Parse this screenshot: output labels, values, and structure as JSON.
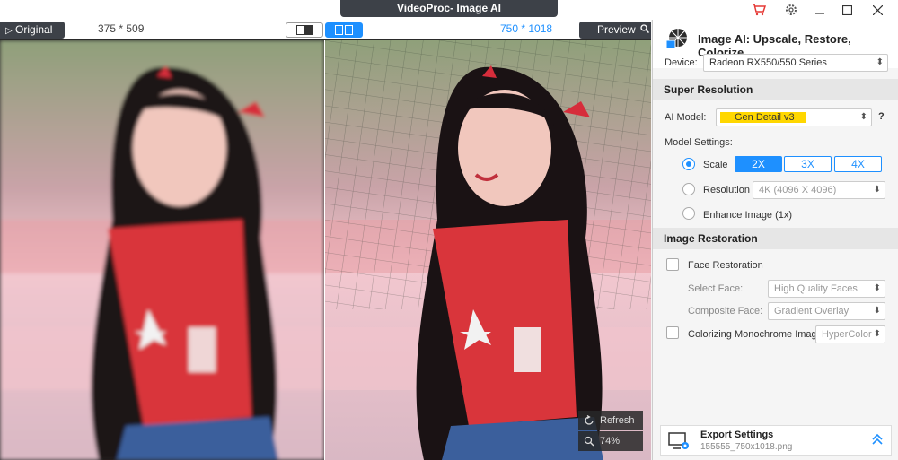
{
  "window": {
    "title": "VideoProc-  Image AI"
  },
  "preview": {
    "original_label": "Original",
    "original_dims": "375 * 509",
    "output_dims": "750 * 1018",
    "preview_label": "Preview",
    "refresh_label": "Refresh",
    "zoom_label": "74%"
  },
  "panel": {
    "title": "Image AI: Upscale, Restore, Colorize",
    "device_label": "Device:",
    "device_value": "Radeon RX550/550 Series",
    "super_resolution": {
      "header": "Super Resolution",
      "ai_model_label": "AI Model:",
      "ai_model_value": "Gen Detail v3",
      "help": "?",
      "model_settings_label": "Model Settings:",
      "scale_label": "Scale",
      "scale_options": [
        "2X",
        "3X",
        "4X"
      ],
      "resolution_label": "Resolution",
      "resolution_value": "4K (4096 X 4096)",
      "enhance_label": "Enhance Image (1x)"
    },
    "image_restoration": {
      "header": "Image Restoration",
      "face_restoration_label": "Face Restoration",
      "select_face_label": "Select Face:",
      "select_face_value": "High Quality Faces",
      "composite_face_label": "Composite Face:",
      "composite_face_value": "Gradient Overlay",
      "colorize_label": "Colorizing Monochrome Image:",
      "colorize_value": "HyperColor"
    },
    "export": {
      "title": "Export Settings",
      "filename": "155555_750x1018.png"
    }
  },
  "colors": {
    "accent": "#1e90ff",
    "dark": "#3d4148",
    "model_highlight": "#ffd700"
  }
}
